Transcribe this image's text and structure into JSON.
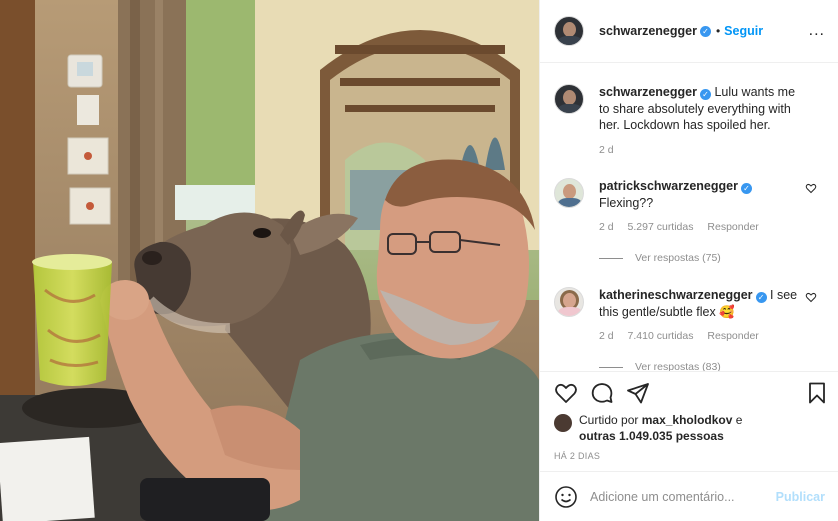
{
  "header": {
    "username": "schwarzenegger",
    "separator": "•",
    "follow_label": "Seguir",
    "more_label": "..."
  },
  "caption": {
    "username": "schwarzenegger",
    "text": "Lulu wants me to share absolutely everything with her. Lockdown has spoiled her.",
    "time": "2 d"
  },
  "comments": [
    {
      "username": "patrickschwarzenegger",
      "text": "Flexing??",
      "time": "2 d",
      "likes": "5.297 curtidas",
      "reply_label": "Responder",
      "view_replies": "Ver respostas (75)"
    },
    {
      "username": "katherineschwarzenegger",
      "text": "I see this gentle/subtle flex",
      "emoji": "🥰",
      "time": "2 d",
      "likes": "7.410 curtidas",
      "reply_label": "Responder",
      "view_replies": "Ver respostas (83)"
    }
  ],
  "likes": {
    "prefix": "Curtido por",
    "user": "max_kholodkov",
    "connector": "e",
    "others": "outras 1.049.035 pessoas"
  },
  "time_ago": "HÁ 2 DIAS",
  "add_comment": {
    "placeholder": "Adicione um comentário...",
    "publish_label": "Publicar"
  },
  "icons": {
    "verified": "verified-badge-icon",
    "like": "heart-icon",
    "comment": "comment-bubble-icon",
    "share": "paper-plane-icon",
    "save": "bookmark-icon",
    "emoji": "smiley-icon"
  },
  "colors": {
    "link_blue": "#0095f6",
    "verified_blue": "#3897f0",
    "secondary_text": "#8e8e8e",
    "publish_disabled": "#b2dffc"
  }
}
